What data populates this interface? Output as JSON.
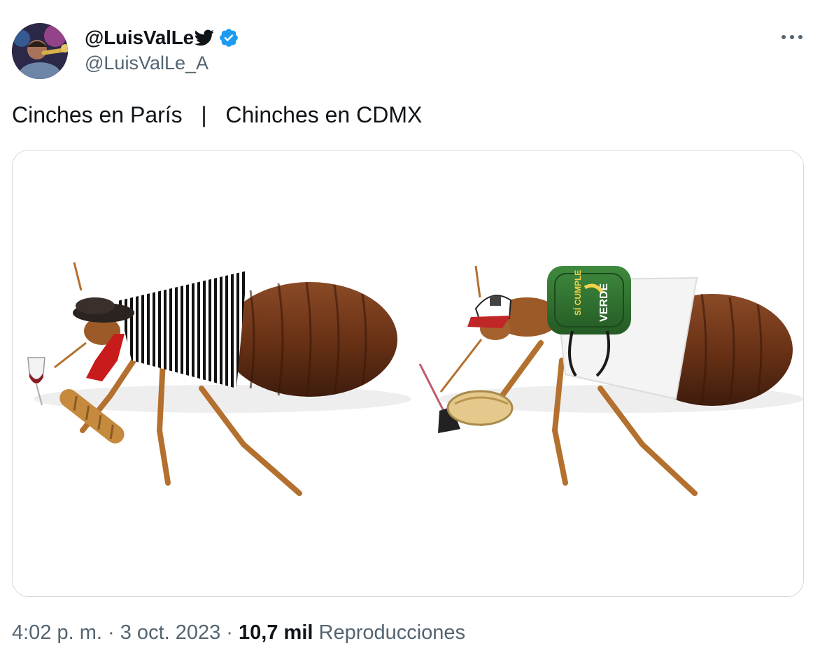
{
  "tweet": {
    "display_name": "@LuisValLe",
    "handle": "@LuisValLe_A",
    "text": "Cinches en París   |   Chinches en CDMX",
    "time": "4:02 p. m.",
    "separator1": " · ",
    "date": "3 oct. 2023",
    "separator2": " · ",
    "views_count": "10,7 mil",
    "views_label": " Reproducciones"
  },
  "icons": {
    "bird": "twitter-bird-icon",
    "verified": "verified-badge-icon",
    "more": "more-options-icon"
  },
  "media": {
    "backpack_text_1": "SÍ CUMPLE",
    "backpack_text_2": "VERDE"
  },
  "colors": {
    "verified_blue": "#1d9bf0",
    "text_primary": "#0f1419",
    "text_secondary": "#536471",
    "border": "#cfd9de"
  }
}
